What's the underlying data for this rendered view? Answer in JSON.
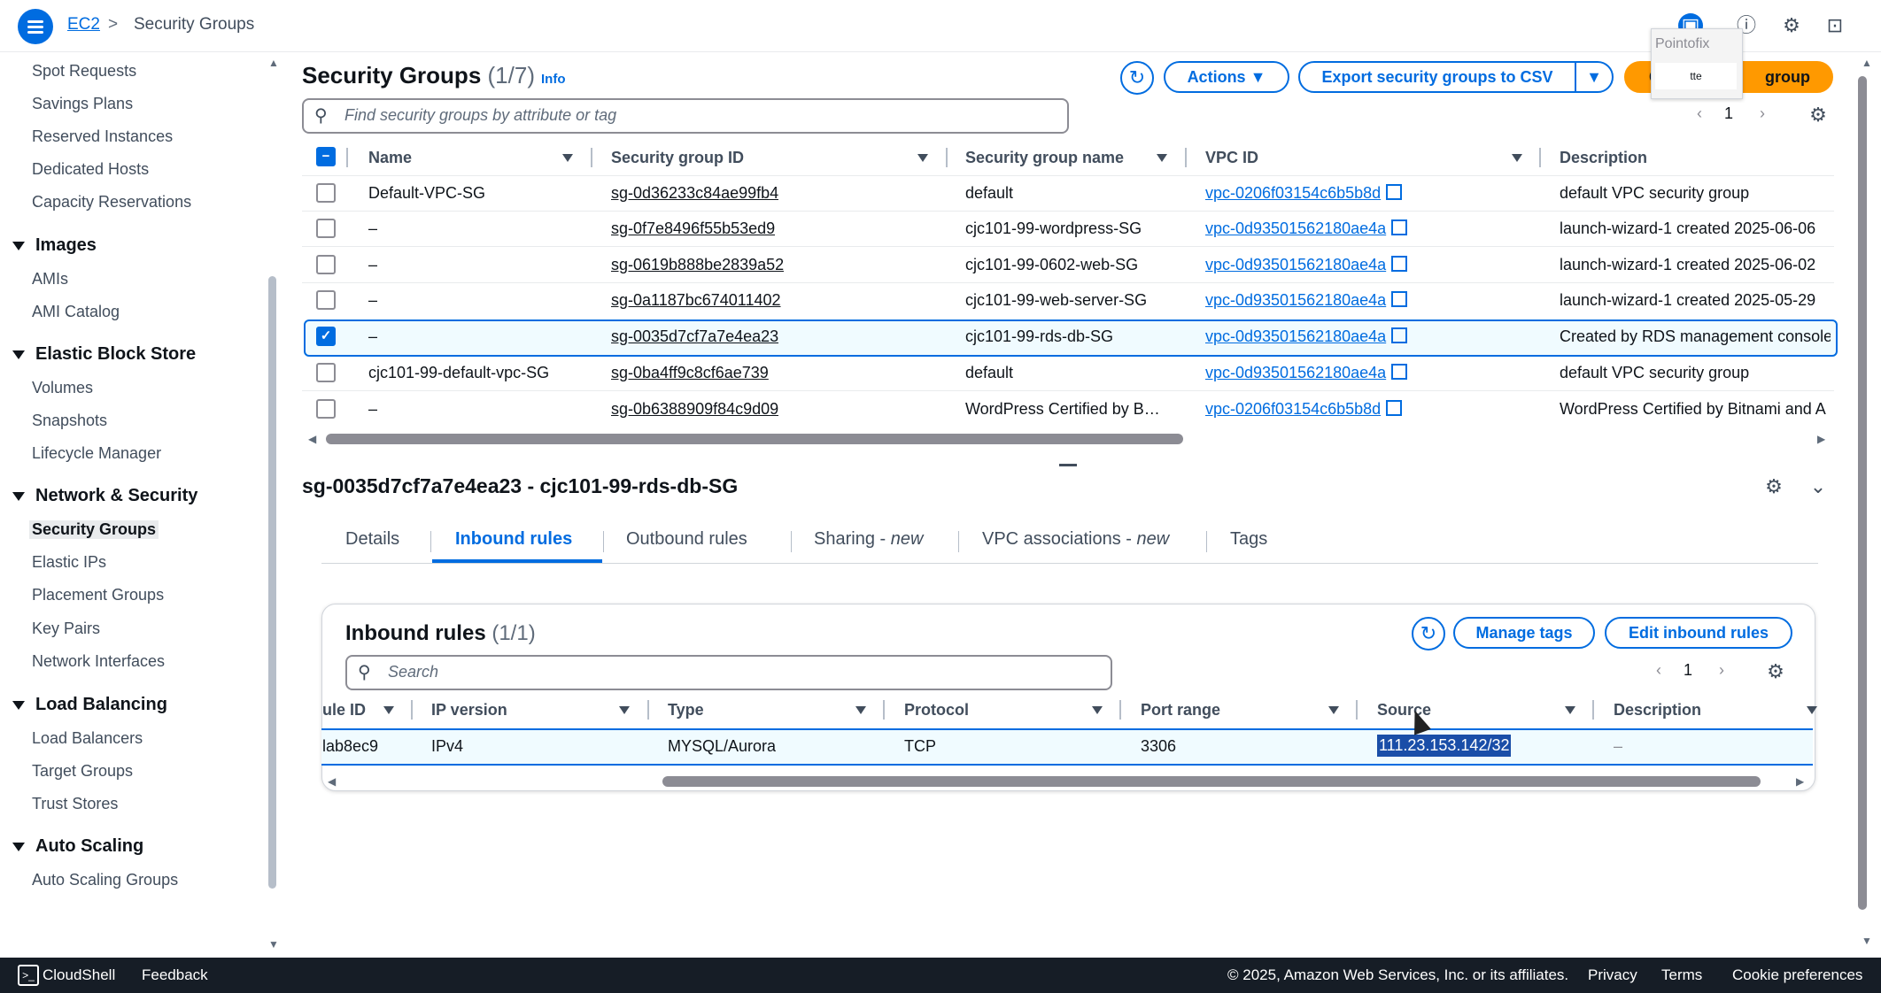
{
  "breadcrumb": {
    "service": "EC2",
    "separator": ">",
    "current": "Security Groups"
  },
  "sidebar": {
    "items_top": [
      "Spot Requests",
      "Savings Plans",
      "Reserved Instances",
      "Dedicated Hosts",
      "Capacity Reservations"
    ],
    "sections": [
      {
        "title": "Images",
        "items": [
          "AMIs",
          "AMI Catalog"
        ]
      },
      {
        "title": "Elastic Block Store",
        "items": [
          "Volumes",
          "Snapshots",
          "Lifecycle Manager"
        ]
      },
      {
        "title": "Network & Security",
        "items": [
          "Security Groups",
          "Elastic IPs",
          "Placement Groups",
          "Key Pairs",
          "Network Interfaces"
        ]
      },
      {
        "title": "Load Balancing",
        "items": [
          "Load Balancers",
          "Target Groups",
          "Trust Stores"
        ]
      },
      {
        "title": "Auto Scaling",
        "items": [
          "Auto Scaling Groups"
        ]
      }
    ],
    "active_item": "Security Groups"
  },
  "list": {
    "title": "Security Groups",
    "count": "(1/7)",
    "info": "Info",
    "actions_label": "Actions",
    "export_label": "Export security groups to CSV",
    "create_label_left": "C",
    "create_label_right": "group",
    "search_placeholder": "Find security groups by attribute or tag",
    "page": "1",
    "columns": [
      "Name",
      "Security group ID",
      "Security group name",
      "VPC ID",
      "Description"
    ],
    "rows": [
      {
        "name": "Default-VPC-SG",
        "id": "sg-0d36233c84ae99fb4",
        "sg_name": "default",
        "vpc": "vpc-0206f03154c6b5b8d",
        "desc": "default VPC security group",
        "selected": false
      },
      {
        "name": "–",
        "id": "sg-0f7e8496f55b53ed9",
        "sg_name": "cjc101-99-wordpress-SG",
        "vpc": "vpc-0d93501562180ae4a",
        "desc": "launch-wizard-1 created 2025-06-06",
        "selected": false
      },
      {
        "name": "–",
        "id": "sg-0619b888be2839a52",
        "sg_name": "cjc101-99-0602-web-SG",
        "vpc": "vpc-0d93501562180ae4a",
        "desc": "launch-wizard-1 created 2025-06-02",
        "selected": false
      },
      {
        "name": "–",
        "id": "sg-0a1187bc674011402",
        "sg_name": "cjc101-99-web-server-SG",
        "vpc": "vpc-0d93501562180ae4a",
        "desc": "launch-wizard-1 created 2025-05-29",
        "selected": false
      },
      {
        "name": "–",
        "id": "sg-0035d7cf7a7e4ea23",
        "sg_name": "cjc101-99-rds-db-SG",
        "vpc": "vpc-0d93501562180ae4a",
        "desc": "Created by RDS management console",
        "selected": true
      },
      {
        "name": "cjc101-99-default-vpc-SG",
        "id": "sg-0ba4ff9c8cf6ae739",
        "sg_name": "default",
        "vpc": "vpc-0d93501562180ae4a",
        "desc": "default VPC security group",
        "selected": false
      },
      {
        "name": "–",
        "id": "sg-0b6388909f84c9d09",
        "sg_name": "WordPress Certified by B…",
        "vpc": "vpc-0206f03154c6b5b8d",
        "desc": "WordPress Certified by Bitnami and A",
        "selected": false
      }
    ]
  },
  "popup": {
    "title": "Pointofix",
    "text": "tte"
  },
  "detail": {
    "title": "sg-0035d7cf7a7e4ea23 - cjc101-99-rds-db-SG",
    "tabs": [
      {
        "label": "Details"
      },
      {
        "label": "Inbound rules",
        "active": true
      },
      {
        "label": "Outbound rules"
      },
      {
        "label": "Sharing - ",
        "suffix": "new"
      },
      {
        "label": "VPC associations - ",
        "suffix": "new"
      },
      {
        "label": "Tags"
      }
    ],
    "inbound": {
      "title": "Inbound rules",
      "count": "(1/1)",
      "manage_tags": "Manage tags",
      "edit": "Edit inbound rules",
      "search_placeholder": "Search",
      "page": "1",
      "columns": [
        "ule ID",
        "IP version",
        "Type",
        "Protocol",
        "Port range",
        "Source",
        "Description"
      ],
      "row": {
        "rule_id": "lab8ec9",
        "ip_version": "IPv4",
        "type": "MYSQL/Aurora",
        "protocol": "TCP",
        "port": "3306",
        "source": "111.2​3.153.142/32",
        "description": "–"
      }
    }
  },
  "footer": {
    "cloudshell": "CloudShell",
    "feedback": "Feedback",
    "copyright": "© 2025, Amazon Web Services, Inc. or its affiliates.",
    "privacy": "Privacy",
    "terms": "Terms",
    "cookies": "Cookie preferences"
  },
  "colors": {
    "accent": "#006ce0",
    "primary_button": "#ff9900",
    "footer_bg": "#161d26"
  }
}
